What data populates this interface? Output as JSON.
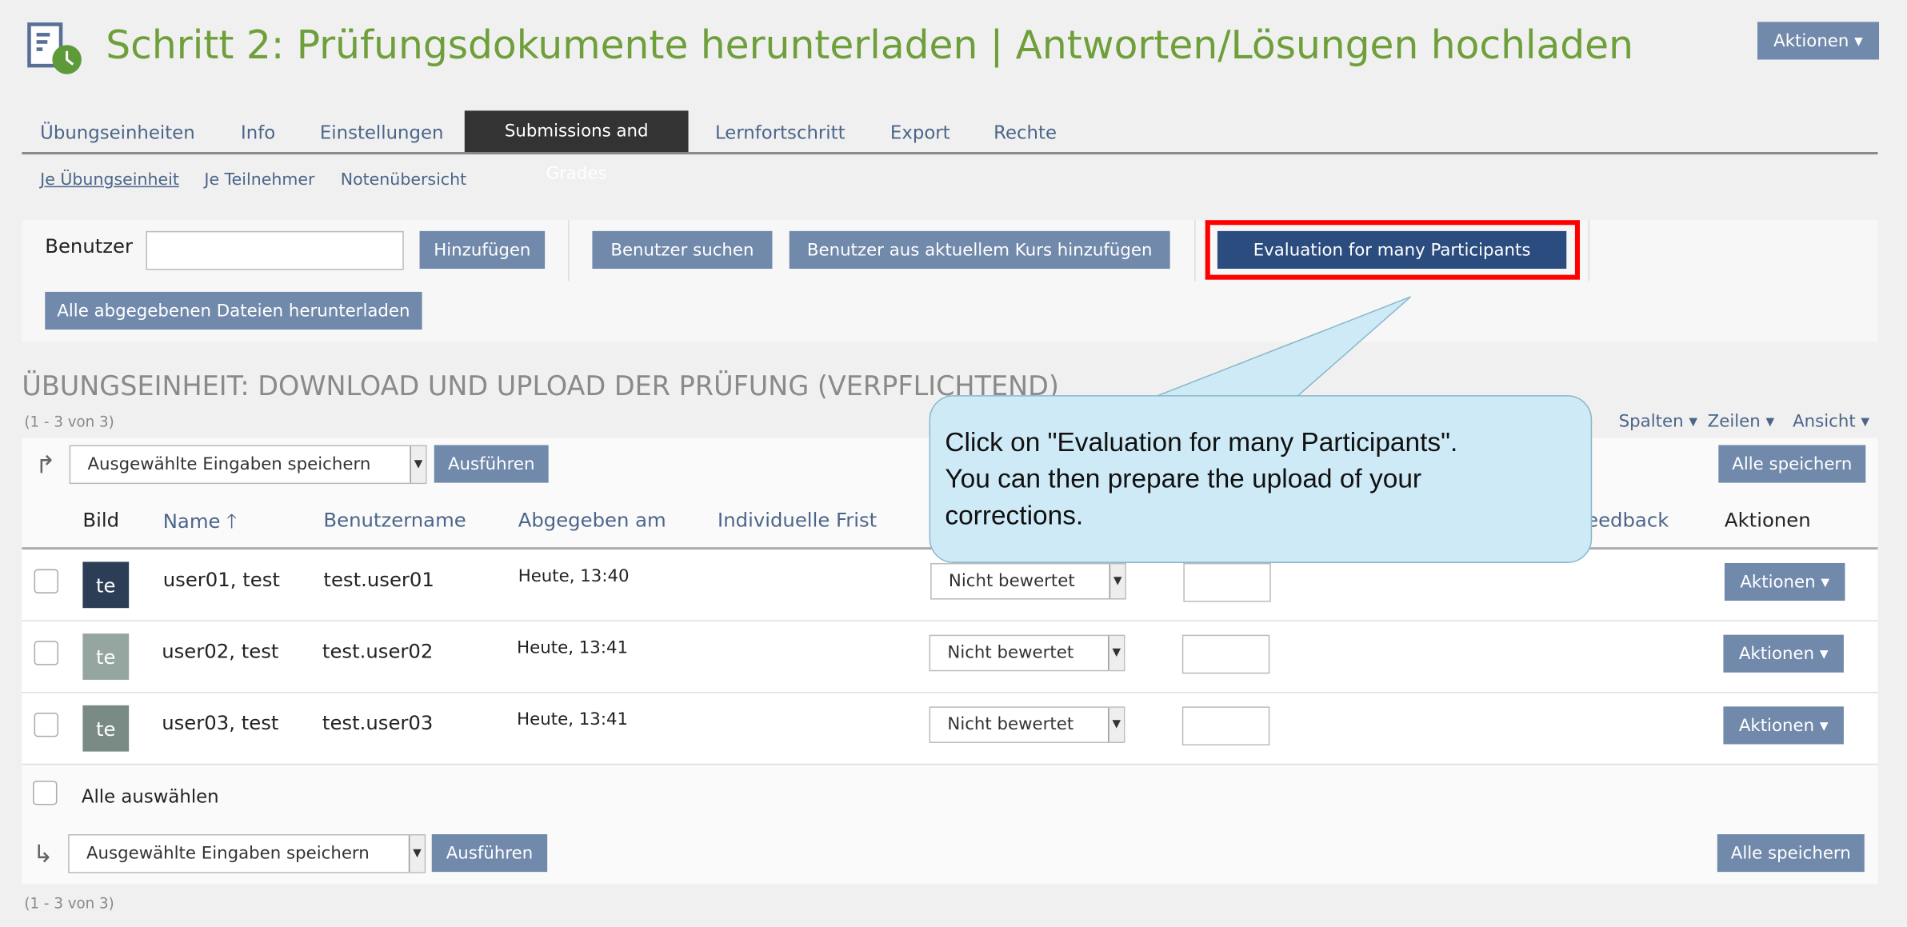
{
  "header": {
    "title": "Schritt 2: Prüfungsdokumente herunterladen | Antworten/Lösungen hochladen",
    "actions_label": "Aktionen ▾",
    "icon": "exercise-clock-icon"
  },
  "tabs": [
    {
      "label": "Übungseinheiten"
    },
    {
      "label": "Info"
    },
    {
      "label": "Einstellungen"
    },
    {
      "label": "Submissions and Grades",
      "active": true
    },
    {
      "label": "Lernfortschritt"
    },
    {
      "label": "Export"
    },
    {
      "label": "Rechte"
    }
  ],
  "subtabs": [
    {
      "label": "Je Übungseinheit",
      "active": true
    },
    {
      "label": "Je Teilnehmer"
    },
    {
      "label": "Notenübersicht"
    }
  ],
  "toolbar": {
    "user_label": "Benutzer",
    "user_value": "",
    "add": "Hinzufügen",
    "search_users": "Benutzer suchen",
    "add_from_course": "Benutzer aus aktuellem Kurs hinzufügen",
    "evaluation": "Evaluation for many Participants",
    "download_all": "Alle abgegebenen Dateien herunterladen"
  },
  "section": {
    "title": "ÜBUNGSEINHEIT: DOWNLOAD UND UPLOAD DER PRÜFUNG (VERPFLICHTEND)",
    "count": "(1 - 3 von 3)",
    "count_bottom": "(1 - 3 von 3)"
  },
  "table_controls": {
    "columns": "Spalten ▾",
    "rows": "Zeilen ▾",
    "view": "Ansicht ▾"
  },
  "actions": {
    "select_value": "Ausgewählte Eingaben speichern",
    "execute": "Ausführen",
    "save_all": "Alle speichern"
  },
  "columns": {
    "image": "Bild",
    "name": "Name",
    "username": "Benutzername",
    "submitted": "Abgegeben am",
    "deadline": "Individuelle Frist",
    "feedback": "Feedback",
    "actions": "Aktionen"
  },
  "rows": [
    {
      "initials": "te",
      "avatar_color": "#2c3e55",
      "name": "user01, test",
      "username": "test.user01",
      "submitted": "Heute, 13:40",
      "status": "Nicht bewertet",
      "mark": "",
      "action": "Aktionen ▾"
    },
    {
      "initials": "te",
      "avatar_color": "#95a5a0",
      "name": "user02, test",
      "username": "test.user02",
      "submitted": "Heute, 13:41",
      "status": "Nicht bewertet",
      "mark": "",
      "action": "Aktionen ▾"
    },
    {
      "initials": "te",
      "avatar_color": "#7a8a85",
      "name": "user03, test",
      "username": "test.user03",
      "submitted": "Heute, 13:41",
      "status": "Nicht bewertet",
      "mark": "",
      "action": "Aktionen ▾"
    }
  ],
  "select_all": "Alle auswählen",
  "callout": {
    "line1": "Click on \"Evaluation for many Participants\".",
    "line2": "You can then prepare the upload of your",
    "line3": "corrections."
  },
  "colors": {
    "title": "#6e9f3a",
    "button": "#7189ab",
    "highlight_button": "#2b4c7f",
    "highlight_border": "#ff0000",
    "callout": "#cdeaf6"
  }
}
